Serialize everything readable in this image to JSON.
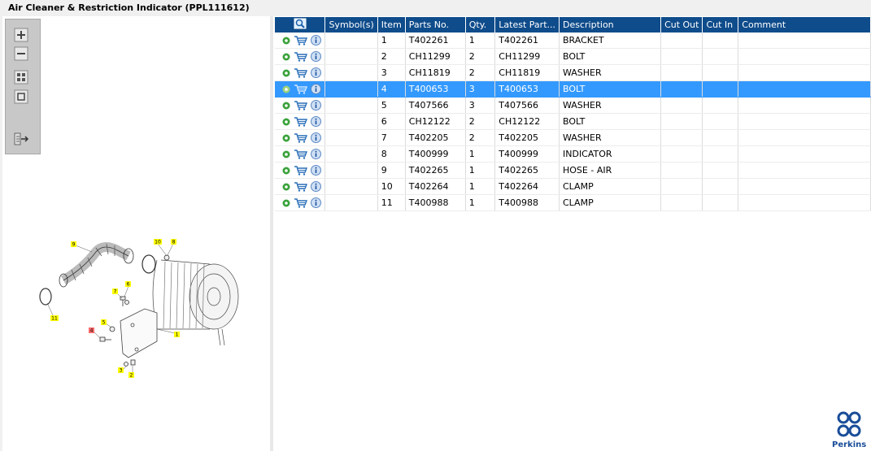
{
  "title": "Air Cleaner & Restriction Indicator (PPL111612)",
  "toolbar": {
    "icons": [
      "zoom-in-icon",
      "zoom-out-icon",
      "fit-grid-icon",
      "actual-size-icon",
      "export-icon"
    ]
  },
  "table": {
    "columns": [
      "",
      "Symbol(s)",
      "Item",
      "Parts No.",
      "Qty.",
      "Latest Part...",
      "Description",
      "Cut Out",
      "Cut In",
      "Comment"
    ],
    "rows": [
      {
        "item": "1",
        "part": "T402261",
        "qty": "1",
        "latest": "T402261",
        "desc": "BRACKET"
      },
      {
        "item": "2",
        "part": "CH11299",
        "qty": "2",
        "latest": "CH11299",
        "desc": "BOLT"
      },
      {
        "item": "3",
        "part": "CH11819",
        "qty": "2",
        "latest": "CH11819",
        "desc": "WASHER"
      },
      {
        "item": "4",
        "part": "T400653",
        "qty": "3",
        "latest": "T400653",
        "desc": "BOLT"
      },
      {
        "item": "5",
        "part": "T407566",
        "qty": "3",
        "latest": "T407566",
        "desc": "WASHER"
      },
      {
        "item": "6",
        "part": "CH12122",
        "qty": "2",
        "latest": "CH12122",
        "desc": "BOLT"
      },
      {
        "item": "7",
        "part": "T402205",
        "qty": "2",
        "latest": "T402205",
        "desc": "WASHER"
      },
      {
        "item": "8",
        "part": "T400999",
        "qty": "1",
        "latest": "T400999",
        "desc": "INDICATOR"
      },
      {
        "item": "9",
        "part": "T402265",
        "qty": "1",
        "latest": "T402265",
        "desc": "HOSE - AIR"
      },
      {
        "item": "10",
        "part": "T402264",
        "qty": "1",
        "latest": "T402264",
        "desc": "CLAMP"
      },
      {
        "item": "11",
        "part": "T400988",
        "qty": "1",
        "latest": "T400988",
        "desc": "CLAMP"
      }
    ],
    "selected_item": "4"
  },
  "callouts": [
    "1",
    "2",
    "3",
    "4",
    "5",
    "6",
    "7",
    "8",
    "9",
    "10",
    "11"
  ],
  "logo": {
    "text": "Perkins"
  },
  "colors": {
    "header_bg": "#0f4c8b",
    "selected_row": "#3399ff",
    "callout_yellow": "#ffff00",
    "callout_red": "#ff6b6b",
    "logo_blue": "#1a4d99"
  }
}
